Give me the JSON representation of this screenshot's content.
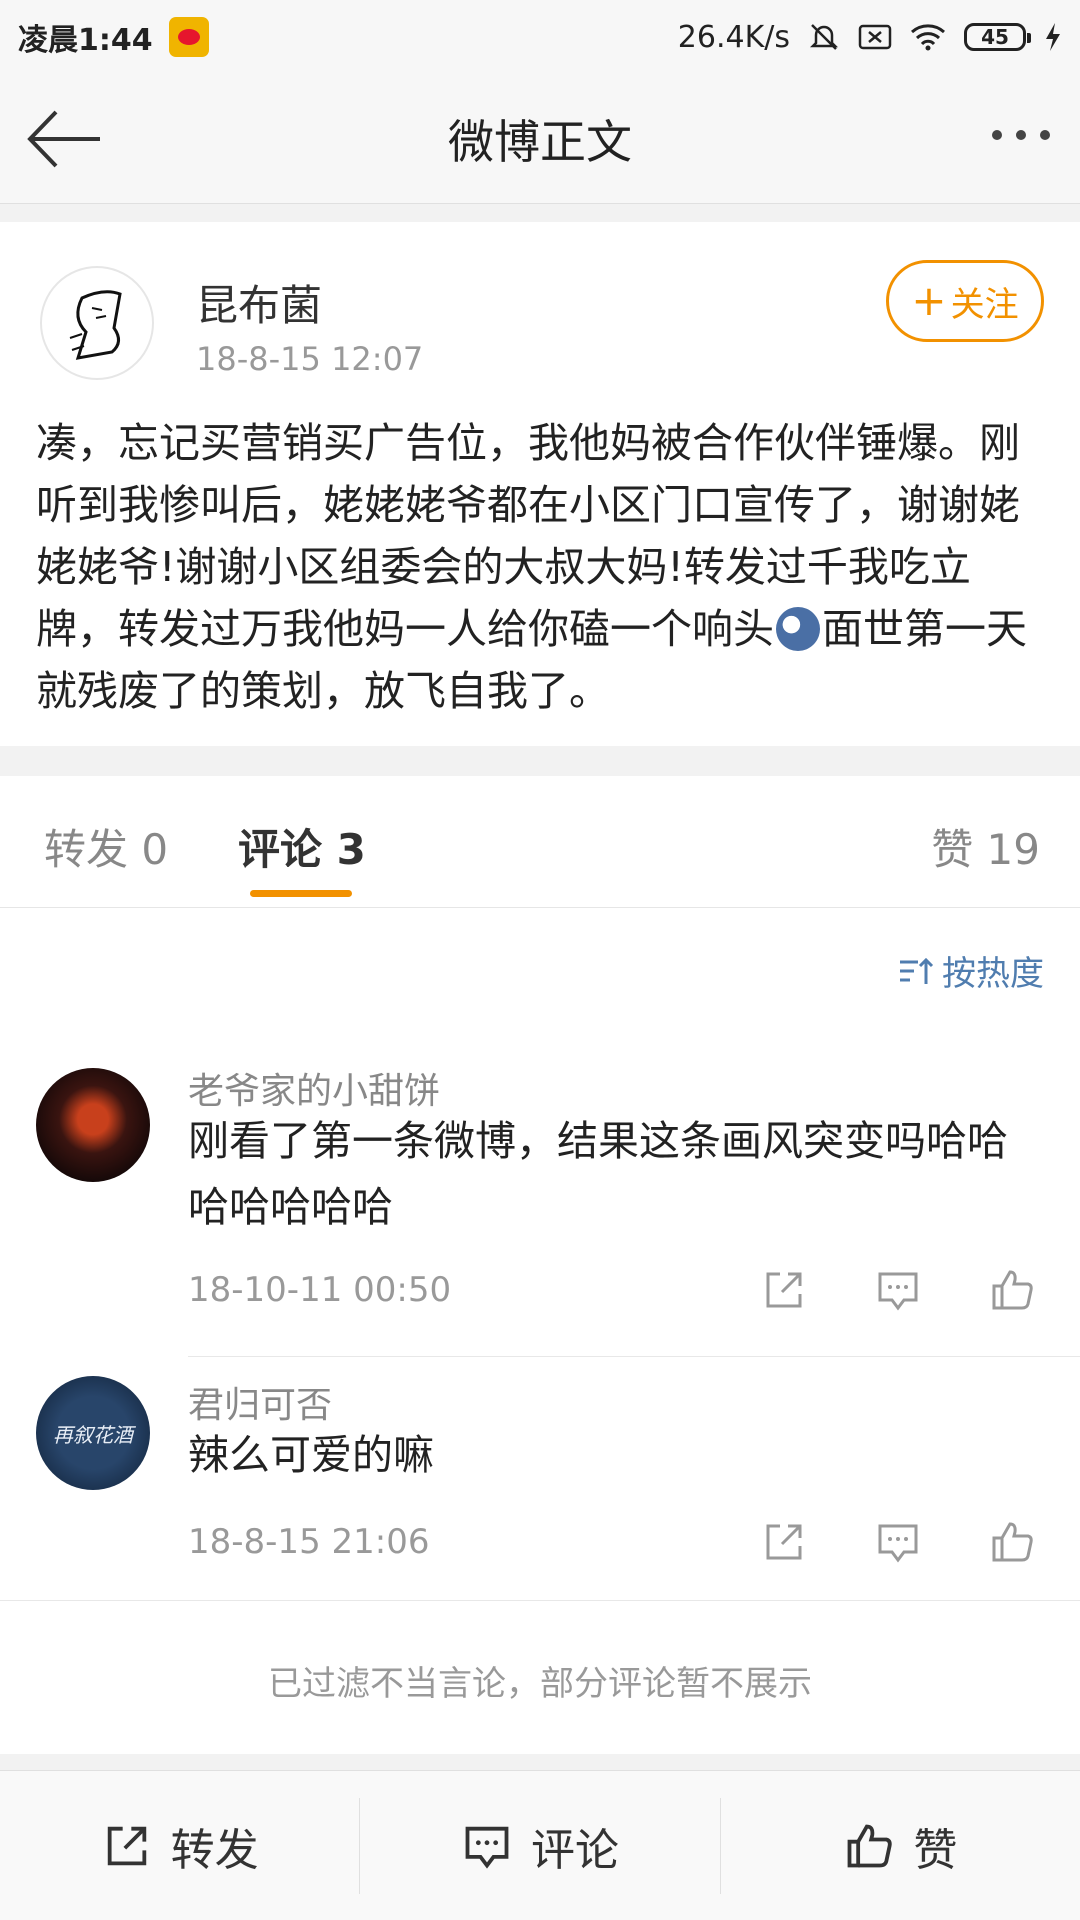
{
  "status_bar": {
    "time": "凌晨1:44",
    "network_speed": "26.4K/s",
    "battery": "45"
  },
  "nav": {
    "title": "微博正文"
  },
  "post": {
    "author": "昆布菌",
    "time": "18-8-15 12:07",
    "follow_label": "关注",
    "text_before_emoji": "凑，忘记买营销买广告位，我他妈被合作伙伴锤爆。刚听到我惨叫后，姥姥姥爷都在小区门口宣传了，谢谢姥姥姥爷!谢谢小区组委会的大叔大妈!转发过千我吃立牌，转发过万我他妈一人给你磕一个响头",
    "text_after_emoji": "面世第一天就残废了的策划，放飞自我了。"
  },
  "tabs": {
    "repost": "转发 0",
    "comments": "评论 3",
    "likes": "赞 19"
  },
  "sort_label": "按热度",
  "comments": [
    {
      "name": "老爷家的小甜饼",
      "text": "刚看了第一条微博，结果这条画风突变吗哈哈哈哈哈哈哈",
      "time": "18-10-11 00:50"
    },
    {
      "name": "君归可否",
      "text": "辣么可爱的嘛",
      "time": "18-8-15 21:06",
      "avatar_text": "再叙花酒"
    }
  ],
  "filter_note": "已过滤不当言论，部分评论暂不展示",
  "bottom_bar": {
    "repost": "转发",
    "comment": "评论",
    "like": "赞"
  },
  "colors": {
    "accent_orange": "#f29100",
    "link_blue": "#507daf"
  },
  "icons": [
    "back-arrow-icon",
    "more-icon",
    "share-icon",
    "comment-icon",
    "like-icon",
    "sort-icon"
  ]
}
